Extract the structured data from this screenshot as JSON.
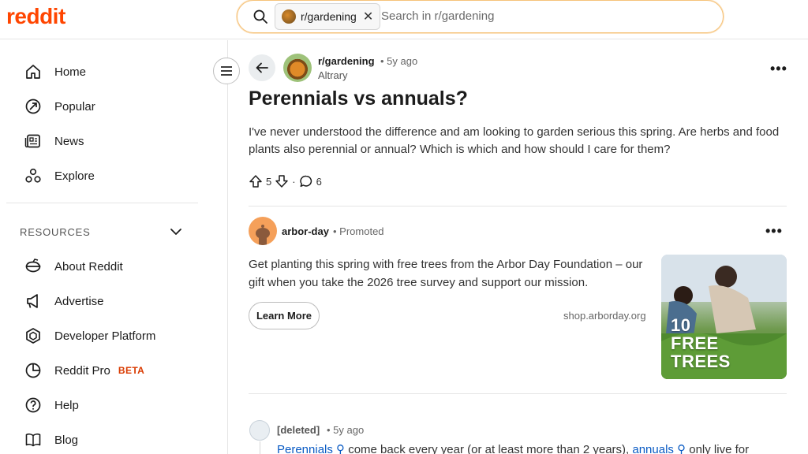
{
  "header": {
    "logo": "reddit",
    "search_chip": "r/gardening",
    "search_chip_close": "✕",
    "search_placeholder": "Search in r/gardening"
  },
  "sidebar": {
    "nav": [
      {
        "label": "Home",
        "icon": "home-icon"
      },
      {
        "label": "Popular",
        "icon": "popular-icon"
      },
      {
        "label": "News",
        "icon": "news-icon"
      },
      {
        "label": "Explore",
        "icon": "explore-icon"
      }
    ],
    "resources_label": "RESOURCES",
    "resources": [
      {
        "label": "About Reddit",
        "icon": "reddit-alien-icon"
      },
      {
        "label": "Advertise",
        "icon": "megaphone-icon"
      },
      {
        "label": "Developer Platform",
        "icon": "developer-hexagon-icon"
      },
      {
        "label": "Reddit Pro",
        "icon": "pie-chart-icon",
        "badge": "BETA"
      },
      {
        "label": "Help",
        "icon": "help-icon"
      },
      {
        "label": "Blog",
        "icon": "book-icon"
      }
    ]
  },
  "post": {
    "subreddit": "r/gardening",
    "age": "• 5y ago",
    "author": "Altrary",
    "title": "Perennials vs annuals?",
    "body": "I've never understood the difference and am looking to garden serious this spring. Are herbs and food plants also perennial or annual? Which is which and how should I care for them?",
    "upvotes": "5",
    "separator": "·",
    "comments": "6",
    "more": "•••"
  },
  "ad": {
    "name": "arbor-day",
    "promoted": "• Promoted",
    "text": "Get planting this spring with free trees from the Arbor Day Foundation – our gift when you take the 2026 tree survey and support our mission.",
    "button": "Learn More",
    "domain": "shop.arborday.org",
    "image_overlay_1": "10",
    "image_overlay_2": "FREE",
    "image_overlay_3": "TREES",
    "more": "•••"
  },
  "comment": {
    "user": "[deleted]",
    "age": "• 5y ago",
    "link1": "Perennials",
    "text1": " come back every year (or at least more than 2 years), ",
    "link2": "annuals",
    "text2": " only live for"
  },
  "colors": {
    "brand": "#ff4500",
    "link": "#0a5bc4",
    "beta": "#d93a00"
  }
}
